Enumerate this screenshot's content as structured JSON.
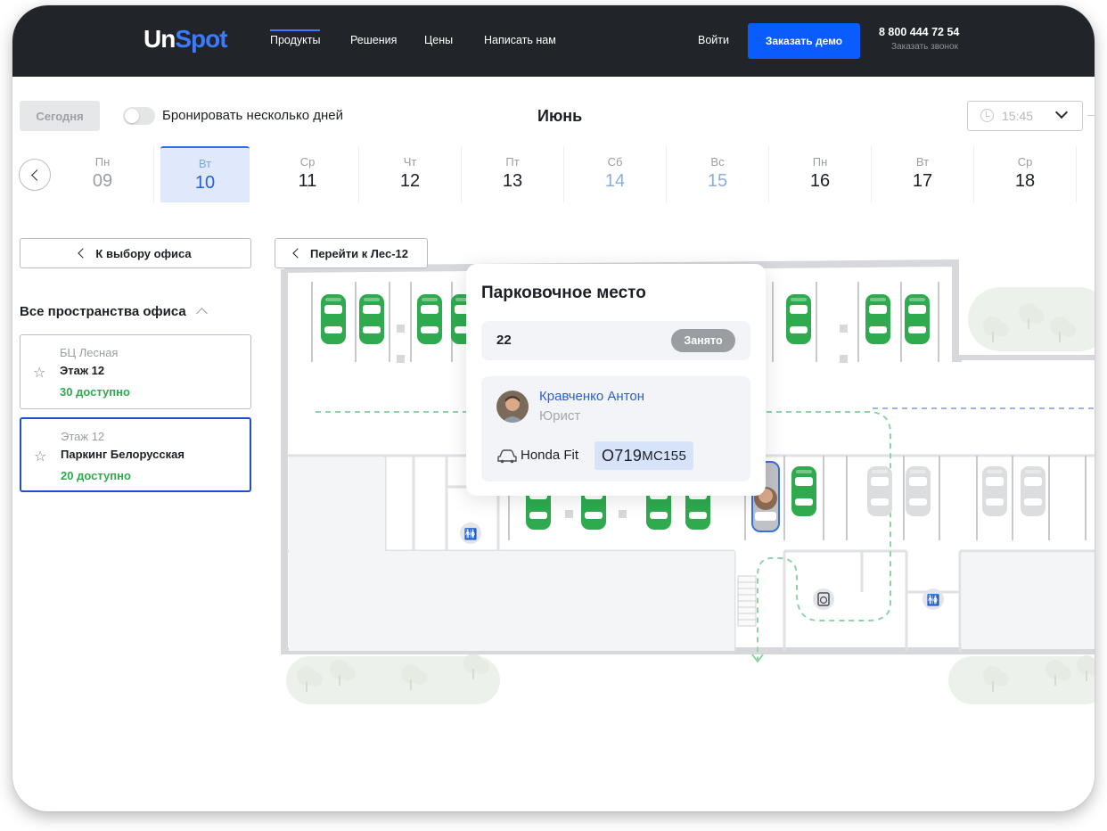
{
  "header": {
    "logo_part1": "Un",
    "logo_part2": "Spot",
    "nav": [
      {
        "label": "Продукты"
      },
      {
        "label": "Решения"
      },
      {
        "label": "Цены"
      },
      {
        "label": "Написать нам"
      }
    ],
    "login": "Войти",
    "demo_button": "Заказать демо",
    "phone": "8 800 444 72 54",
    "callback": "Заказать звонок",
    "accent_color": "#0a5cff",
    "background_color": "#212429"
  },
  "toolbar": {
    "today_button": "Сегодня",
    "multi_days_label": "Бронировать несколько дней",
    "multi_days_enabled": false,
    "month": "Июнь",
    "time_value": "15:45"
  },
  "dates": [
    {
      "dow": "Пн",
      "day": "09",
      "state": "past"
    },
    {
      "dow": "Вт",
      "day": "10",
      "state": "selected"
    },
    {
      "dow": "Ср",
      "day": "11",
      "state": "normal"
    },
    {
      "dow": "Чт",
      "day": "12",
      "state": "normal"
    },
    {
      "dow": "Пт",
      "day": "13",
      "state": "normal"
    },
    {
      "dow": "Сб",
      "day": "14",
      "state": "weekend"
    },
    {
      "dow": "Вс",
      "day": "15",
      "state": "weekend"
    },
    {
      "dow": "Пн",
      "day": "16",
      "state": "normal"
    },
    {
      "dow": "Вт",
      "day": "17",
      "state": "normal"
    },
    {
      "dow": "Ср",
      "day": "18",
      "state": "normal"
    }
  ],
  "sidebar": {
    "back_button": "К выбору офиса",
    "spaces_title": "Все пространства офиса",
    "offices": [
      {
        "building": "БЦ Лесная",
        "name": "Этаж 12",
        "available": "30 доступно",
        "selected": false
      },
      {
        "building": "Этаж 12",
        "name": "Паркинг Белорусская",
        "available": "20 доступно",
        "selected": true
      }
    ]
  },
  "map": {
    "goto_button": "Перейти к Лес-12",
    "free_color": "#2faa4f",
    "occupied_color": "#d9dadc"
  },
  "popup": {
    "title": "Парковочное место",
    "spot_number": "22",
    "status": "Занято",
    "user_name": "Кравченко Антон",
    "user_role": "Юрист",
    "car_model": "Honda Fit",
    "plate_big": "О719",
    "plate_small": "МС155"
  }
}
